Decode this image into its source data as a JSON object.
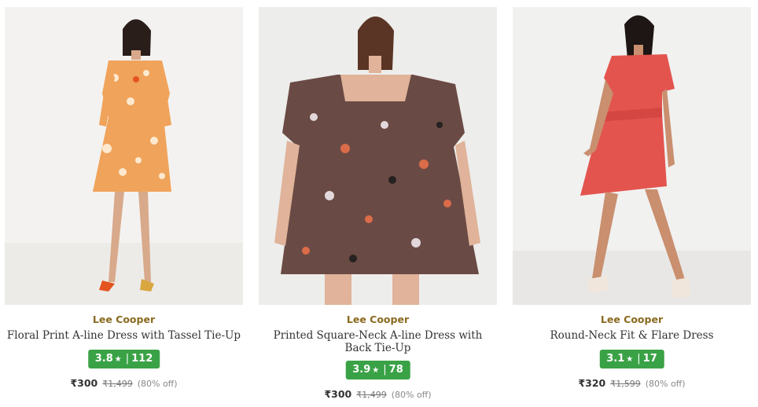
{
  "products": [
    {
      "brand": "Lee Cooper",
      "title": "Floral Print A-line Dress with Tassel Tie-Up",
      "rating": "3.8",
      "reviews": "112",
      "price": "₹300",
      "mrp": "₹1,499",
      "discount": "(80% off)",
      "dress_color": "#f0a35a"
    },
    {
      "brand": "Lee Cooper",
      "title": "Printed Square-Neck A-line Dress with Back Tie-Up",
      "rating": "3.9",
      "reviews": "78",
      "price": "₹300",
      "mrp": "₹1,499",
      "discount": "(80% off)",
      "dress_color": "#6a4a44"
    },
    {
      "brand": "Lee Cooper",
      "title": "Round-Neck Fit & Flare Dress",
      "rating": "3.1",
      "reviews": "17",
      "price": "₹320",
      "mrp": "₹1,599",
      "discount": "(80% off)",
      "dress_color": "#e4544f"
    }
  ],
  "rating_star": "★",
  "rating_separator": "|",
  "colors": {
    "brand": "#8a6a1f",
    "rating_bg": "#3aa246"
  }
}
